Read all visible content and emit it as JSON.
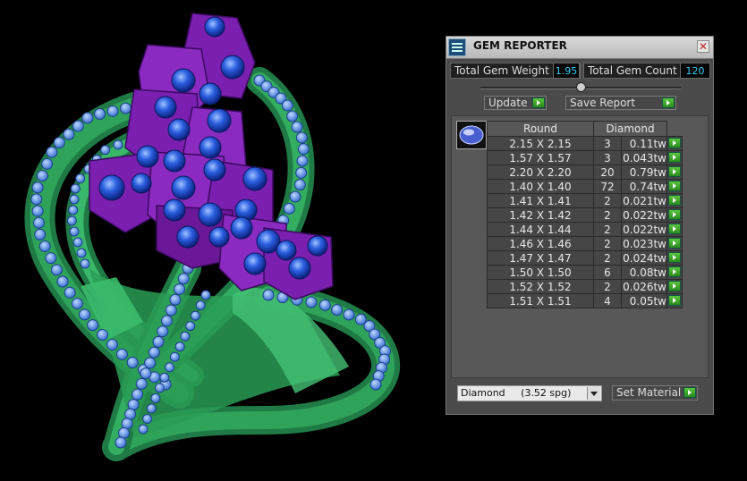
{
  "panel": {
    "title": "GEM REPORTER",
    "close_glyph": "✕",
    "icon": "gem-reporter-app-icon",
    "total_weight_label": "Total Gem Weight",
    "total_weight_value": "1.95",
    "total_count_label": "Total Gem Count",
    "total_count_value": "120",
    "update_label": "Update",
    "save_report_label": "Save Report",
    "table": {
      "shape_header": "Round",
      "material_header": "Diamond",
      "rows": [
        {
          "size": "2.15 X 2.15",
          "qty": "3",
          "weight": "0.11tw"
        },
        {
          "size": "1.57 X 1.57",
          "qty": "3",
          "weight": "0.043tw"
        },
        {
          "size": "2.20 X 2.20",
          "qty": "20",
          "weight": "0.79tw"
        },
        {
          "size": "1.40 X 1.40",
          "qty": "72",
          "weight": "0.74tw"
        },
        {
          "size": "1.41 X 1.41",
          "qty": "2",
          "weight": "0.021tw"
        },
        {
          "size": "1.42 X 1.42",
          "qty": "2",
          "weight": "0.022tw"
        },
        {
          "size": "1.44 X 1.44",
          "qty": "2",
          "weight": "0.022tw"
        },
        {
          "size": "1.46 X 1.46",
          "qty": "2",
          "weight": "0.023tw"
        },
        {
          "size": "1.47 X 1.47",
          "qty": "2",
          "weight": "0.024tw"
        },
        {
          "size": "1.50 X 1.50",
          "qty": "6",
          "weight": "0.08tw"
        },
        {
          "size": "1.52 X 1.52",
          "qty": "2",
          "weight": "0.026tw"
        },
        {
          "size": "1.51 X 1.51",
          "qty": "4",
          "weight": "0.05tw"
        }
      ]
    },
    "material_select_value": "Diamond     (3.52 spg)",
    "set_material_label": "Set Material"
  },
  "colors": {
    "viewport_bg": "#000000",
    "metal_green": "#2fa35a",
    "setting_purple": "#7a1fb0",
    "gem_blue": "#2a54d8",
    "value_cyan": "#38c9f0",
    "go_green": "#3aa82a"
  }
}
